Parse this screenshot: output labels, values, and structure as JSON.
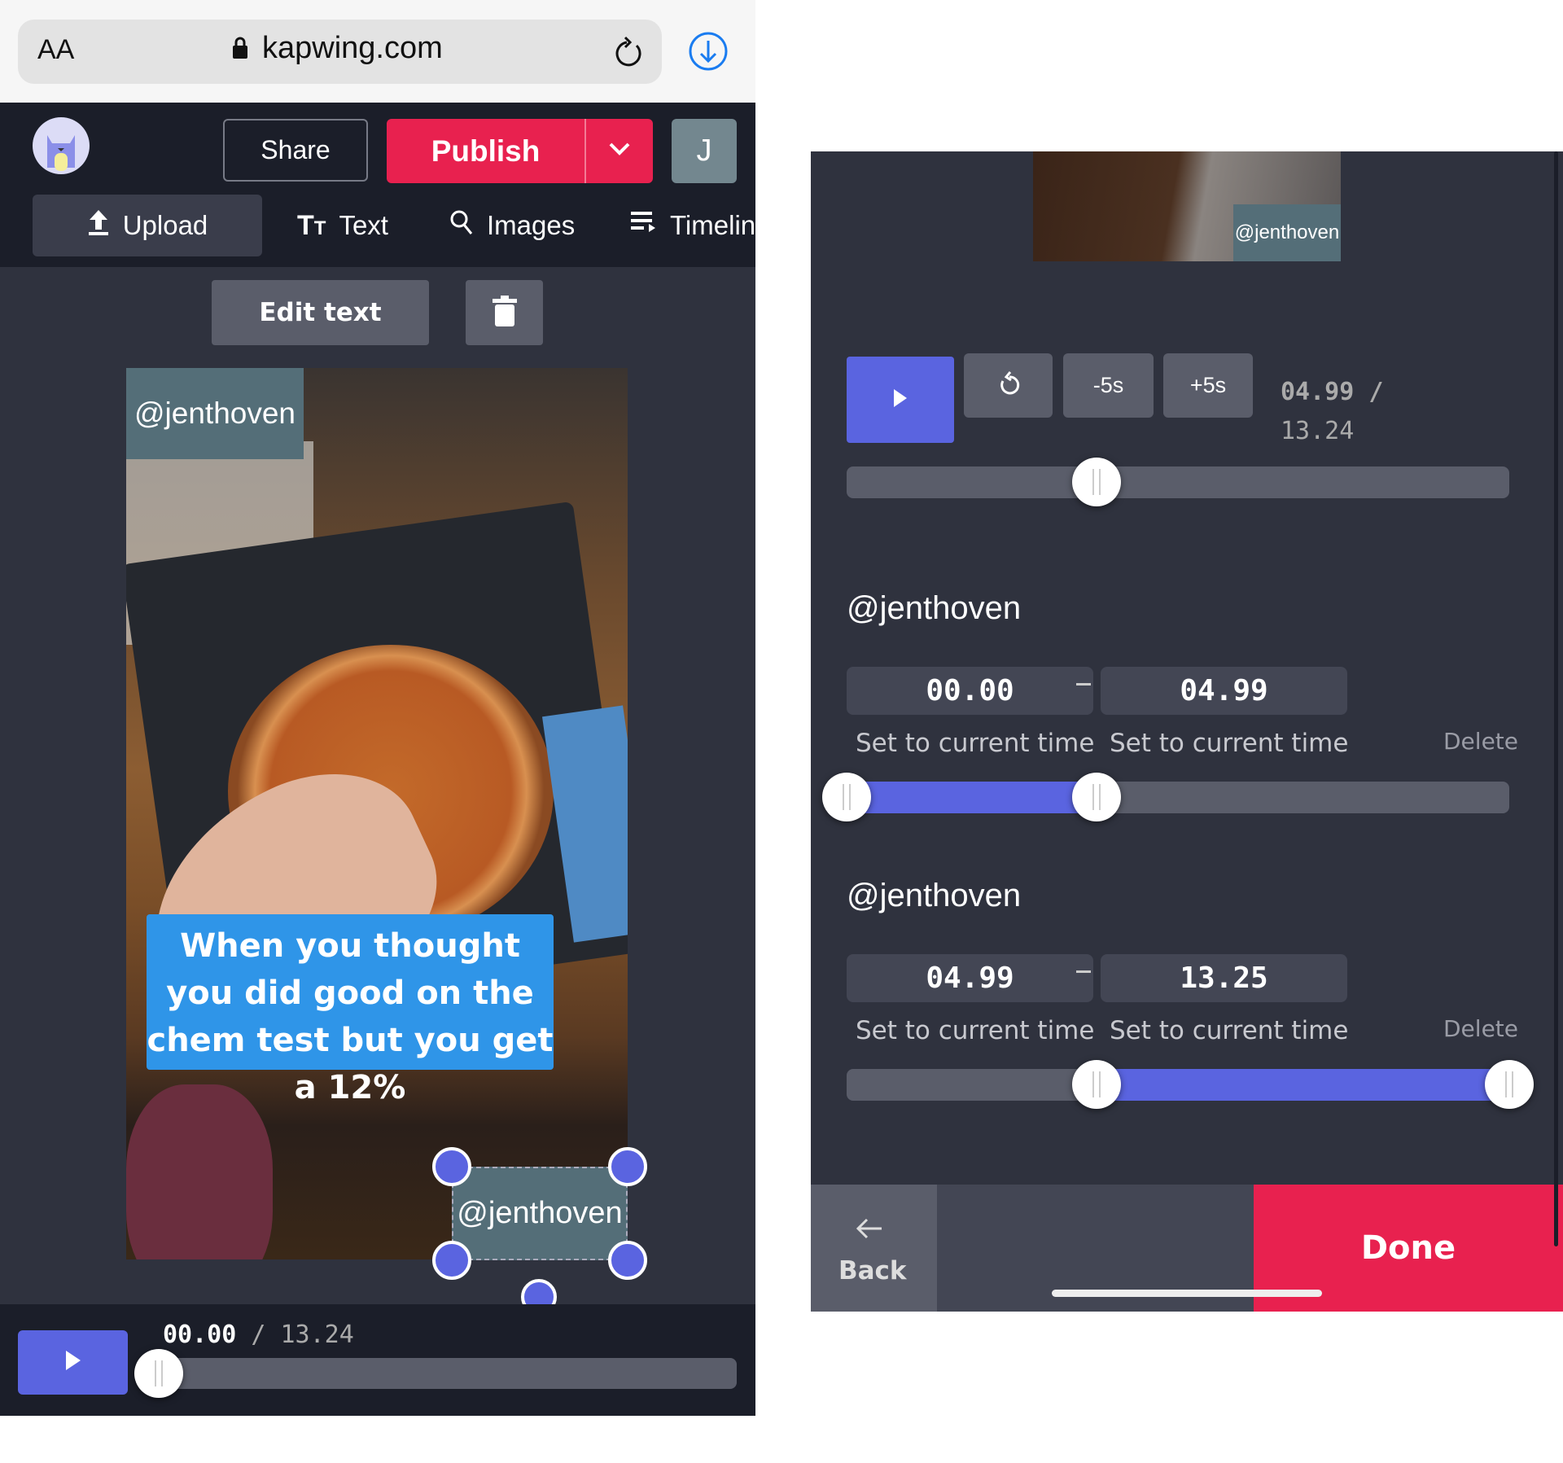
{
  "browser": {
    "text_size_label": "AA",
    "url": "kapwing.com",
    "icons": [
      "lock-icon",
      "reload-icon",
      "download-icon"
    ]
  },
  "header": {
    "share_label": "Share",
    "publish_label": "Publish",
    "user_initial": "J"
  },
  "toolbar": {
    "items": [
      {
        "label": "Upload",
        "icon": "upload-icon"
      },
      {
        "label": "Text",
        "icon": "text-icon"
      },
      {
        "label": "Images",
        "icon": "search-icon"
      },
      {
        "label": "Timelin",
        "icon": "timeline-icon"
      }
    ]
  },
  "edit_bar": {
    "edit_text_label": "Edit text"
  },
  "video": {
    "top_label": "@jenthoven",
    "caption": "When you thought you did good on the chem test but you get a 12%",
    "selected_label": "@jenthoven"
  },
  "player": {
    "current": "00.00",
    "separator": "/",
    "total": "13.24",
    "progress": 0
  },
  "right": {
    "preview_label": "@jenthoven",
    "controls": {
      "minus5_label": "-5s",
      "plus5_label": "+5s",
      "current": "04.99 /",
      "total": "13.24",
      "progress": 0.377
    },
    "layers": [
      {
        "title": "@jenthoven",
        "start": "00.00",
        "end": "04.99",
        "set_current": "Set to current time",
        "delete_label": "Delete",
        "range": [
          0,
          0.377
        ]
      },
      {
        "title": "@jenthoven",
        "start": "04.99",
        "end": "13.25",
        "set_current": "Set to current time",
        "delete_label": "Delete",
        "range": [
          0.377,
          1
        ]
      }
    ],
    "footer": {
      "back_label": "Back",
      "done_label": "Done"
    }
  },
  "colors": {
    "accent": "#5a64e0",
    "publish": "#e8214f",
    "header_bg": "#1b1e29",
    "panel_bg": "#2f323e",
    "label_bg": "#546e78",
    "caption_bg": "#2f95e8"
  }
}
